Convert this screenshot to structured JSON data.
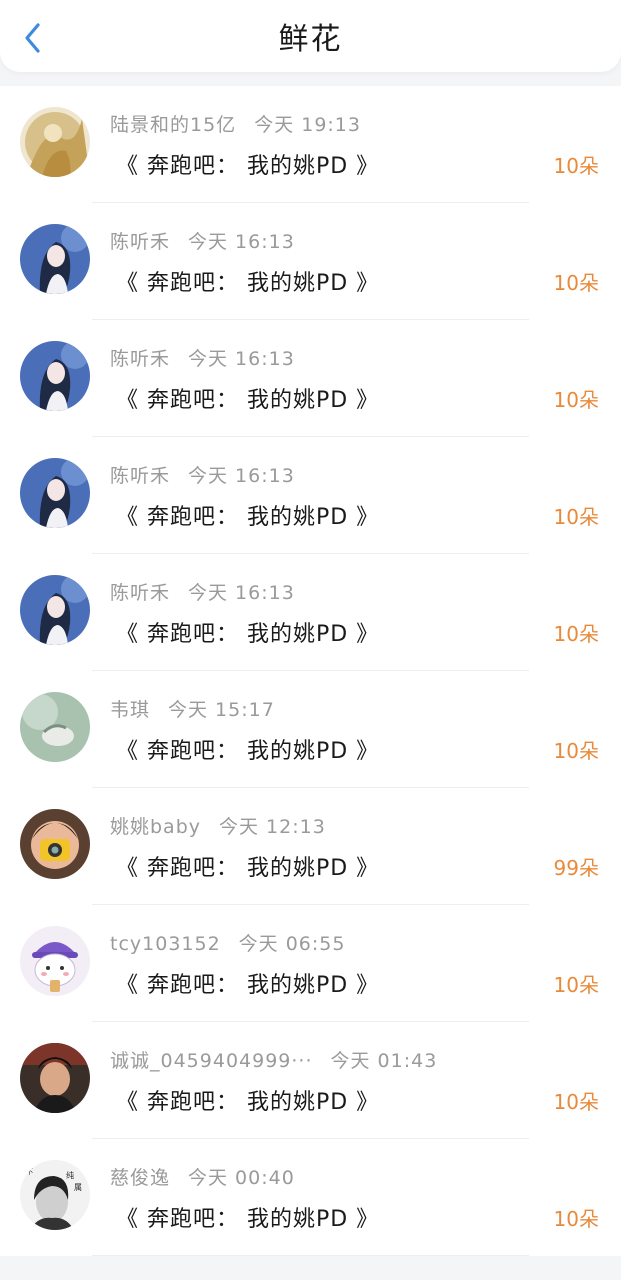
{
  "header": {
    "title": "鲜花",
    "back_icon": "chevron-left-icon",
    "accent_color": "#3d8be0"
  },
  "colors": {
    "count": "#e88a3a",
    "meta": "#9a9a9a"
  },
  "rows": [
    {
      "user": "陆景和的15亿",
      "time": "今天 19:13",
      "work": "《 奔跑吧： 我的姚PD 》",
      "count": "10朵",
      "avatar": "golden-figure"
    },
    {
      "user": "陈听禾",
      "time": "今天 16:13",
      "work": "《 奔跑吧： 我的姚PD 》",
      "count": "10朵",
      "avatar": "girl-blue"
    },
    {
      "user": "陈听禾",
      "time": "今天 16:13",
      "work": "《 奔跑吧： 我的姚PD 》",
      "count": "10朵",
      "avatar": "girl-blue"
    },
    {
      "user": "陈听禾",
      "time": "今天 16:13",
      "work": "《 奔跑吧： 我的姚PD 》",
      "count": "10朵",
      "avatar": "girl-blue"
    },
    {
      "user": "陈听禾",
      "time": "今天 16:13",
      "work": "《 奔跑吧： 我的姚PD 》",
      "count": "10朵",
      "avatar": "girl-blue"
    },
    {
      "user": "韦琪",
      "time": "今天 15:17",
      "work": "《 奔跑吧： 我的姚PD 》",
      "count": "10朵",
      "avatar": "green-soft"
    },
    {
      "user": "姚姚baby",
      "time": "今天 12:13",
      "work": "《 奔跑吧： 我的姚PD 》",
      "count": "99朵",
      "avatar": "kid-camera"
    },
    {
      "user": "tcy103152",
      "time": "今天 06:55",
      "work": "《 奔跑吧： 我的姚PD 》",
      "count": "10朵",
      "avatar": "cartoon-bear"
    },
    {
      "user": "诚诚_0459404999···",
      "time": "今天 01:43",
      "work": "《 奔跑吧： 我的姚PD 》",
      "count": "10朵",
      "avatar": "boy-dark"
    },
    {
      "user": "慈俊逸",
      "time": "今天 00:40",
      "work": "《 奔跑吧： 我的姚PD 》",
      "count": "10朵",
      "avatar": "bw-calligraphy"
    }
  ]
}
